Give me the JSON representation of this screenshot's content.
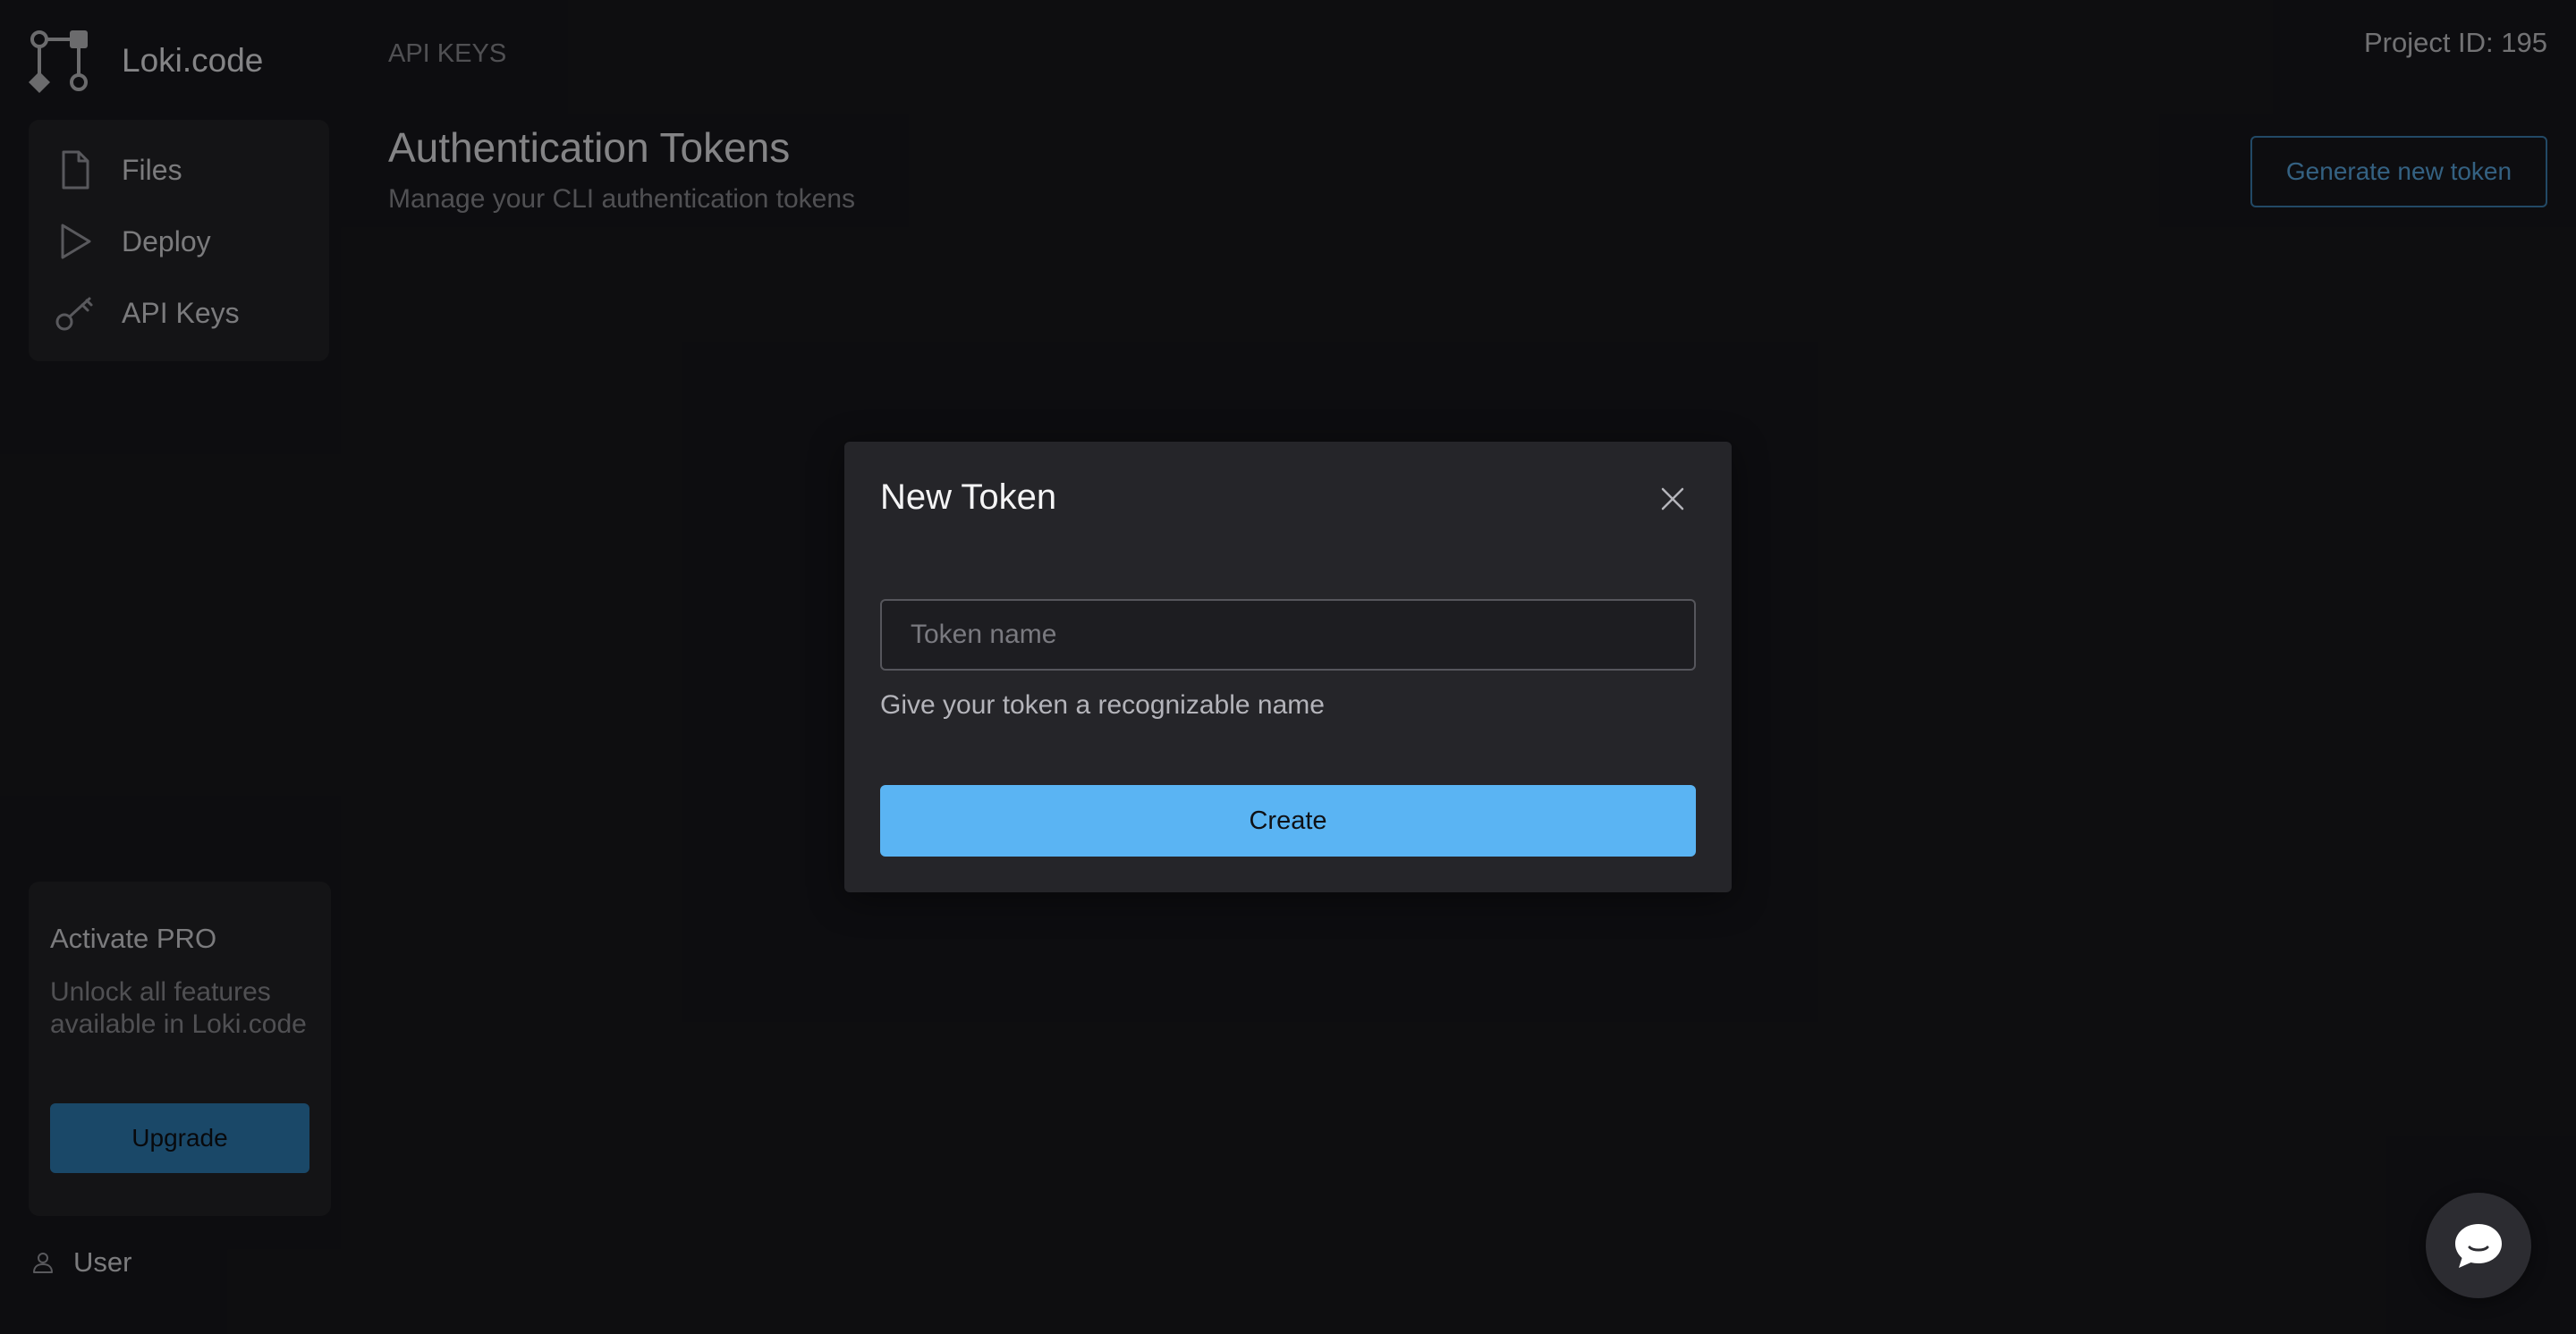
{
  "app": {
    "name": "Loki.code",
    "logo_icon": "branch-diagram-icon"
  },
  "sidebar": {
    "items": [
      {
        "label": "Files",
        "icon": "file-icon"
      },
      {
        "label": "Deploy",
        "icon": "play-icon"
      },
      {
        "label": "API Keys",
        "icon": "key-icon"
      }
    ],
    "promo": {
      "title": "Activate PRO",
      "text": "Unlock all features available in Loki.code",
      "button_label": "Upgrade"
    },
    "user": {
      "label": "User",
      "icon": "user-icon"
    }
  },
  "header": {
    "breadcrumb": "API KEYS",
    "project_id": "Project ID: 195"
  },
  "page": {
    "title": "Authentication Tokens",
    "subtitle": "Manage your CLI authentication tokens",
    "generate_button": "Generate new token"
  },
  "modal": {
    "title": "New Token",
    "input_placeholder": "Token name",
    "input_value": "",
    "helper_text": "Give your token a recognizable name",
    "create_button": "Create",
    "close_icon": "close-icon"
  },
  "chat": {
    "icon": "chat-bubble-icon"
  },
  "colors": {
    "background": "#18181c",
    "panel": "#232327",
    "accent": "#5ab4f3",
    "upgrade": "#2e7cb4"
  }
}
